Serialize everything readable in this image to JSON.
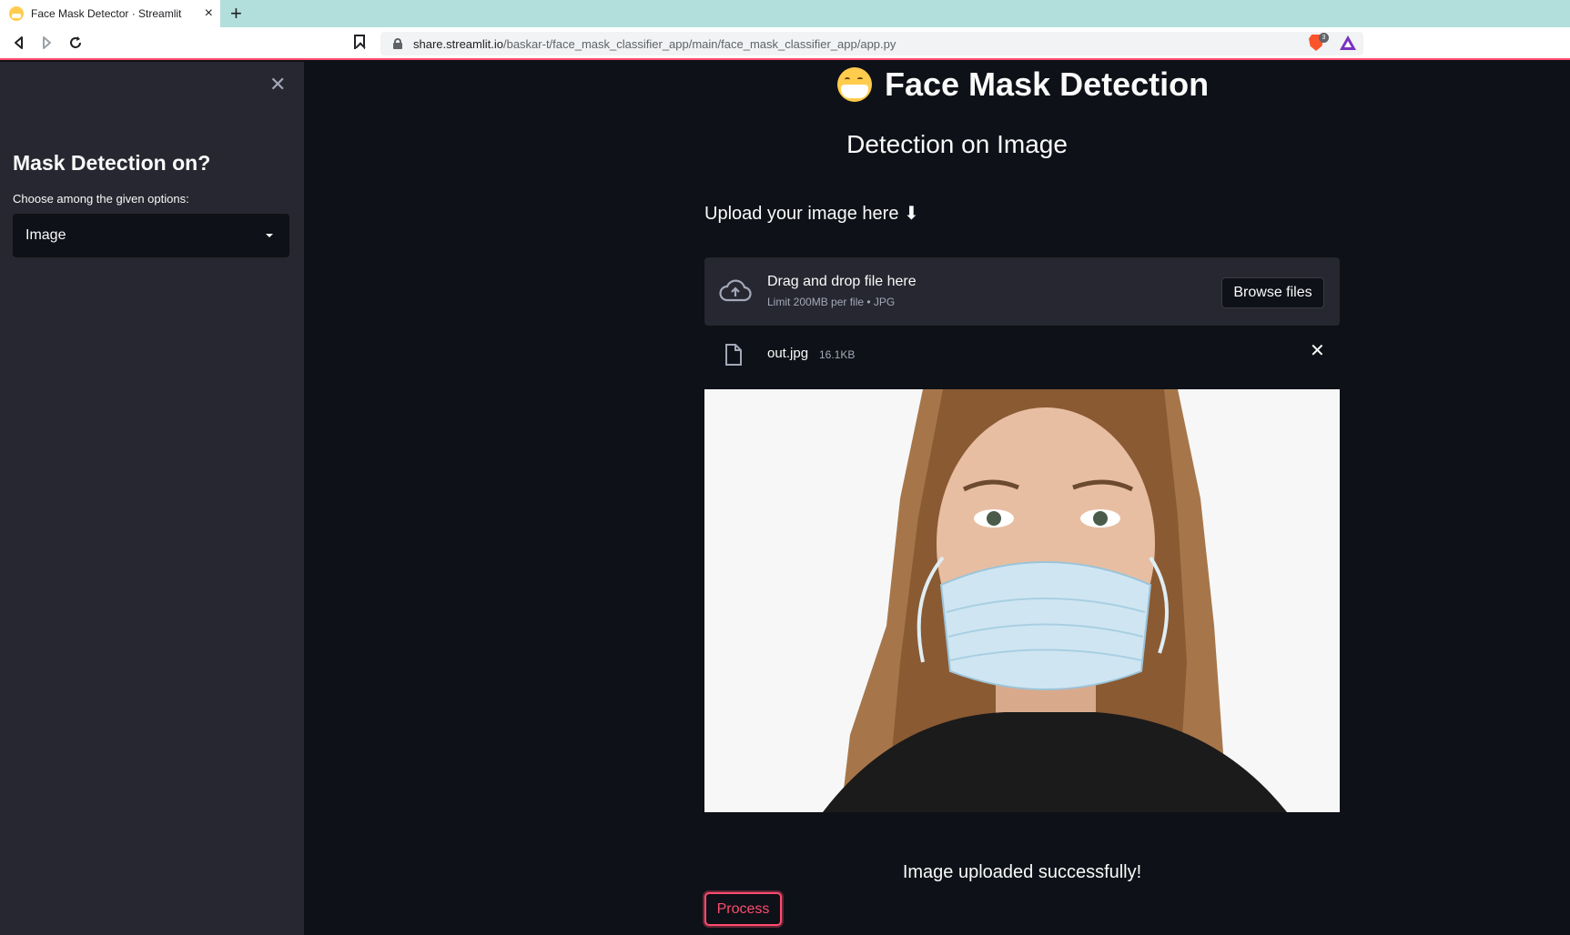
{
  "browser": {
    "tab_title": "Face Mask Detector · Streamlit",
    "url_domain": "share.streamlit.io",
    "url_path": "/baskar-t/face_mask_classifier_app/main/face_mask_classifier_app/app.py",
    "shields_count": "3"
  },
  "sidebar": {
    "heading": "Mask Detection on?",
    "select_label": "Choose among the given options:",
    "select_value": "Image"
  },
  "main": {
    "title": "Face Mask Detection",
    "subtitle": "Detection on Image",
    "upload_label": "Upload your image here ⬇",
    "dropzone_title": "Drag and drop file here",
    "dropzone_limit": "Limit 200MB per file • JPG",
    "browse_label": "Browse files",
    "file_name": "out.jpg",
    "file_size": "16.1KB",
    "status": "Image uploaded successfully!",
    "process_label": "Process"
  },
  "colors": {
    "accent": "#ff4b6e",
    "background": "#0e1117",
    "sidebar": "#262730"
  }
}
